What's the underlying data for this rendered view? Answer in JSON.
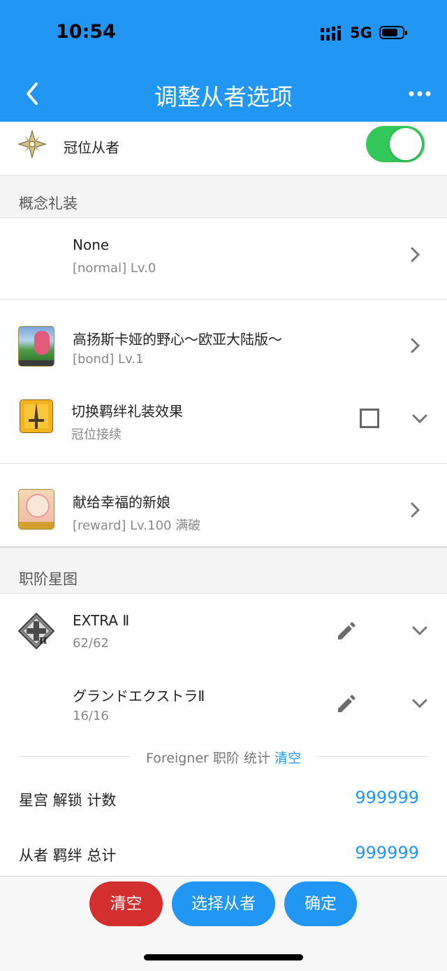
{
  "status_bar": {
    "time": "10:54",
    "network": "5G"
  },
  "nav": {
    "title": "调整从者选项"
  },
  "grand_servant": {
    "label": "冠位从者",
    "toggle_on": true
  },
  "craft_essence": {
    "header": "概念礼装",
    "items": [
      {
        "name": "None",
        "detail": "[normal] Lv.0"
      },
      {
        "name": "高扬斯卡娅的野心～欧亚大陆版～",
        "detail": "[bond] Lv.1"
      },
      {
        "name": "切换羁绊礼装效果",
        "detail": "冠位接续",
        "checked": false
      },
      {
        "name": "献给幸福的新娘",
        "detail": "[reward] Lv.100 满破"
      }
    ]
  },
  "class_board": {
    "header": "职阶星图",
    "items": [
      {
        "name": "EXTRA Ⅱ",
        "detail": "62/62"
      },
      {
        "name": "グランドエクストラⅡ",
        "detail": "16/16"
      }
    ],
    "stats_caption": "Foreigner 职阶 统计",
    "stats_clear": "清空",
    "stats": [
      {
        "label": "星宫 解锁 计数",
        "value": "999999"
      },
      {
        "label": "从者 羁绊 总计",
        "value": "999999"
      }
    ]
  },
  "actions": {
    "clear": "清空",
    "select": "选择从者",
    "confirm": "确定"
  },
  "colors": {
    "primary": "#2196f3",
    "danger": "#d32f2f",
    "toggle": "#33c759"
  }
}
